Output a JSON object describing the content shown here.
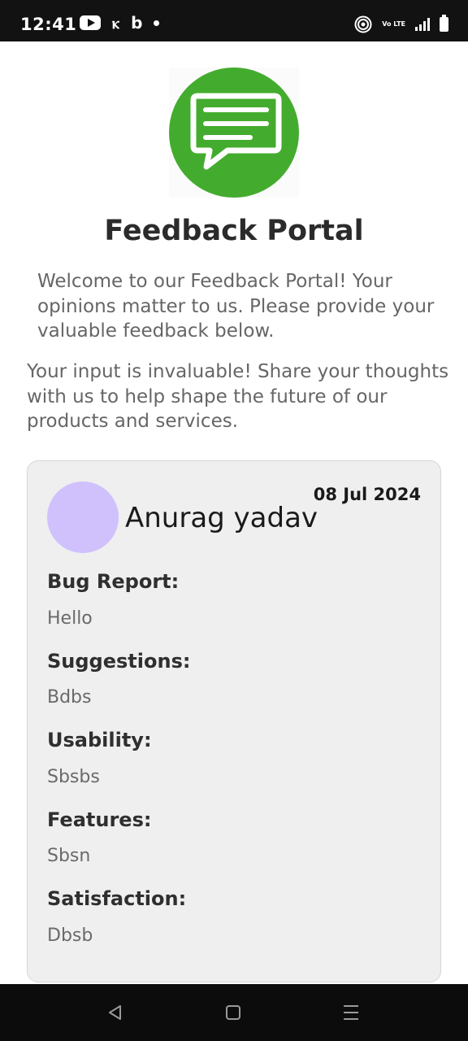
{
  "status_bar": {
    "time": "12:41",
    "apps": [
      "youtube-icon",
      "kiwi-icon",
      "bing-icon",
      "notification-dot-icon"
    ],
    "network": "Vo LTE"
  },
  "header": {
    "logo_icon": "chat-bubble-icon",
    "logo_color": "#43ac2e",
    "title": "Feedback Portal",
    "welcome": "Welcome to our Feedback Portal! Your opinions matter to us. Please provide your valuable feedback below.",
    "intro": "Your input is invaluable! Share your thoughts with us to help shape the future of our products and services."
  },
  "feedback": {
    "user_name": "Anurag yadav",
    "date": "08 Jul 2024",
    "avatar_color": "#d0c1fd",
    "fields": [
      {
        "label": "Bug Report:",
        "value": "Hello"
      },
      {
        "label": "Suggestions:",
        "value": "Bdbs"
      },
      {
        "label": "Usability:",
        "value": "Sbsbs"
      },
      {
        "label": "Features:",
        "value": "Sbsn"
      },
      {
        "label": "Satisfaction:",
        "value": "Dbsb"
      }
    ]
  },
  "nav_bar": {
    "buttons": [
      "back-icon",
      "home-icon",
      "menu-icon"
    ]
  }
}
